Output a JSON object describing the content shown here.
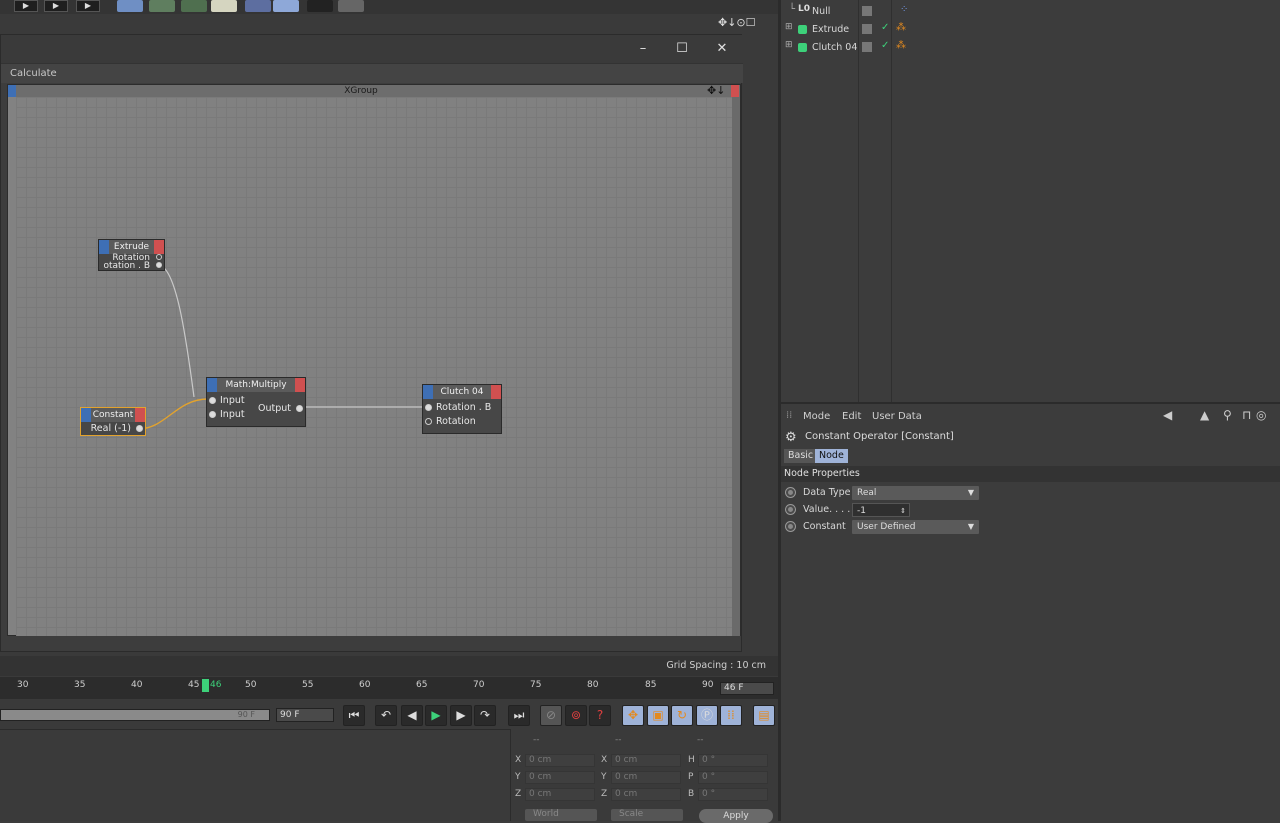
{
  "toolbar": {
    "play_labels": [
      "▶",
      "▶",
      "▶"
    ]
  },
  "xpresso_window": {
    "menu_item": "Calculate",
    "group_title": "XGroup",
    "controls": {
      "minimize": "–",
      "maximize": "☐",
      "close": "✕"
    },
    "status": "Grid Spacing : 10 cm"
  },
  "nodes": {
    "extrude": {
      "title": "Extrude",
      "ports": [
        "Rotation",
        "otation . B"
      ]
    },
    "constant": {
      "title": "Constant",
      "ports": [
        "Real (-1)"
      ]
    },
    "multiply": {
      "title": "Math:Multiply",
      "inputs": [
        "Input",
        "Input"
      ],
      "output": "Output"
    },
    "clutch": {
      "title": "Clutch 04",
      "ports": [
        "Rotation . B",
        "Rotation"
      ]
    }
  },
  "timeline": {
    "ticks": [
      "30",
      "35",
      "40",
      "45",
      "46",
      "50",
      "55",
      "60",
      "65",
      "70",
      "75",
      "80",
      "85",
      "90"
    ],
    "current_frame": "46 F",
    "range_end": "90 F",
    "end_field": "90 F"
  },
  "coordinates": {
    "headers": [
      "--",
      "--",
      "--"
    ],
    "rows": [
      {
        "l1": "X",
        "v1": "0 cm",
        "l2": "X",
        "v2": "0 cm",
        "l3": "H",
        "v3": "0 °"
      },
      {
        "l1": "Y",
        "v1": "0 cm",
        "l2": "Y",
        "v2": "0 cm",
        "l3": "P",
        "v3": "0 °"
      },
      {
        "l1": "Z",
        "v1": "0 cm",
        "l2": "Z",
        "v2": "0 cm",
        "l3": "B",
        "v3": "0 °"
      }
    ],
    "space": "World",
    "mode": "Scale",
    "apply": "Apply"
  },
  "objects": [
    {
      "name": "Null"
    },
    {
      "name": "Extrude"
    },
    {
      "name": "Clutch 04"
    }
  ],
  "attributes": {
    "menu": [
      "Mode",
      "Edit",
      "User Data"
    ],
    "title": "Constant Operator [Constant]",
    "tabs": [
      "Basic",
      "Node"
    ],
    "section": "Node Properties",
    "props": [
      {
        "label": "Data Type",
        "value": "Real"
      },
      {
        "label": "Value. . . .",
        "value": "-1"
      },
      {
        "label": "Constant",
        "value": "User Defined"
      }
    ]
  },
  "colors": {
    "accent_blue": "#3e6fb5",
    "port_red": "#d05050",
    "selection_orange": "#e3a32d",
    "playhead_green": "#3dd17a"
  }
}
